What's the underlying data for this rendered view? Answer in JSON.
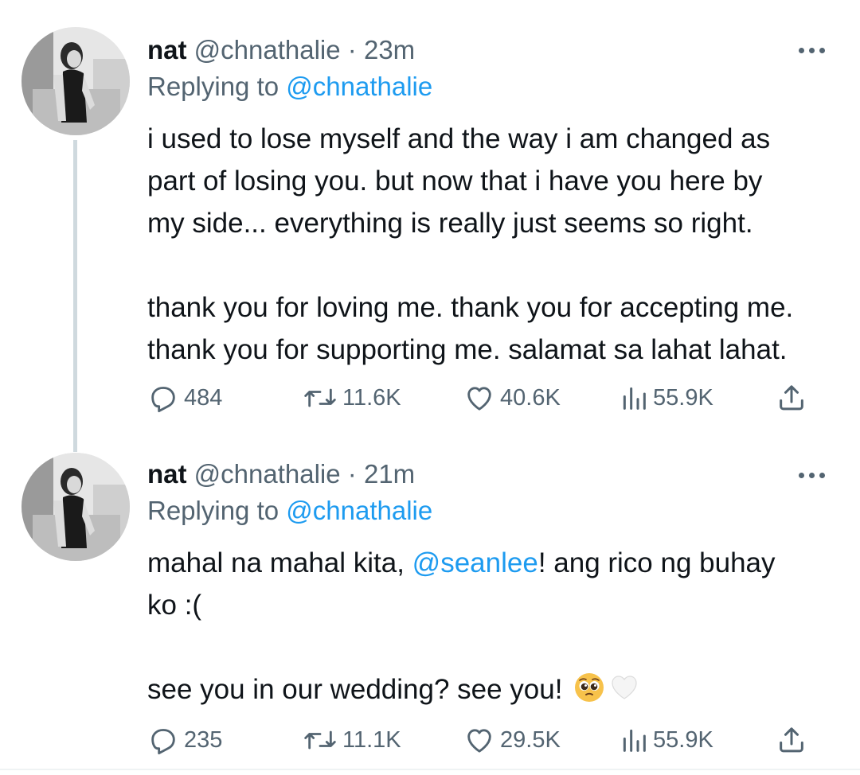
{
  "tweets": [
    {
      "name": "nat",
      "handle": "@chnathalie",
      "dot": "·",
      "time": "23m",
      "replying_prefix": "Replying to",
      "replying_to": "@chnathalie",
      "body": {
        "line1": "i used to lose myself and the way i am changed as",
        "line2": "part of losing you. but now that i have you here by",
        "line3": "my side... everything is really just seems so right.",
        "line4": "thank you for loving me. thank you for accepting me.",
        "line5": "thank you for supporting me. salamat sa lahat lahat."
      },
      "stats": {
        "replies": "484",
        "retweets": "11.6K",
        "likes": "40.6K",
        "views": "55.9K"
      }
    },
    {
      "name": "nat",
      "handle": "@chnathalie",
      "dot": "·",
      "time": "21m",
      "replying_prefix": "Replying to",
      "replying_to": "@chnathalie",
      "body": {
        "pre_mention": "mahal na mahal kita, ",
        "mention": "@seanlee",
        "post_mention": "! ang rico ng buhay",
        "line2": "ko :(",
        "line3": "see you in our wedding? see you! "
      },
      "stats": {
        "replies": "235",
        "retweets": "11.1K",
        "likes": "29.5K",
        "views": "55.9K"
      }
    }
  ],
  "icons": {
    "reply": "reply-icon",
    "retweet": "retweet-icon",
    "like": "heart-icon",
    "views": "views-icon",
    "share": "share-icon",
    "more": "more-icon"
  },
  "colors": {
    "link": "#1d9bf0",
    "secondary": "#536471",
    "text": "#0f1419"
  }
}
